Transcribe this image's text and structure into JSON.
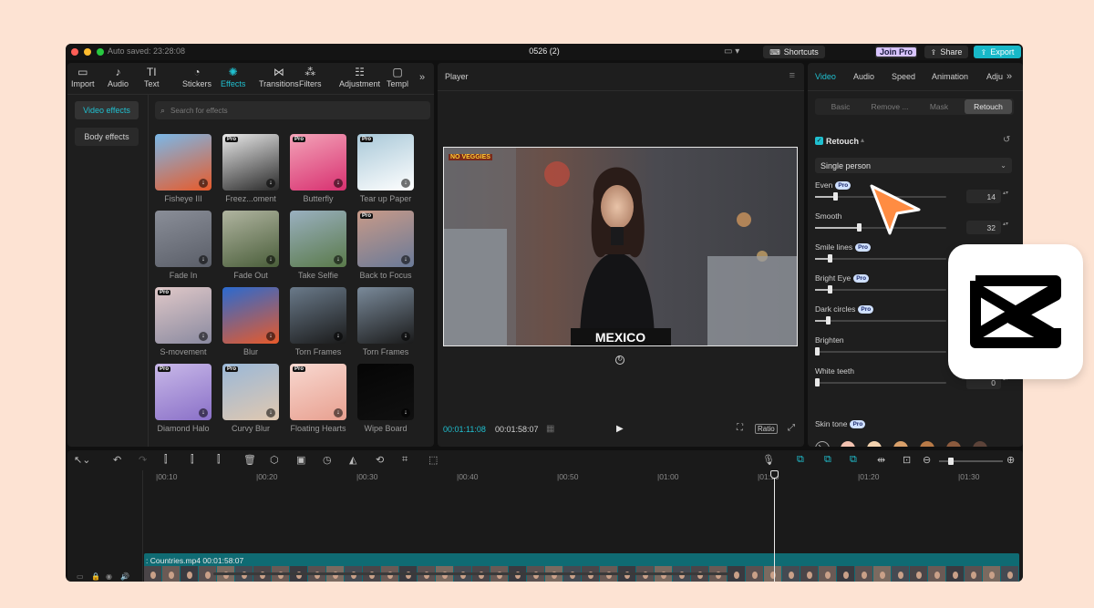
{
  "titlebar": {
    "autosave": "Auto saved: 23:28:08",
    "project": "0526 (2)",
    "shortcuts": "Shortcuts",
    "join_pro": "Join Pro",
    "share": "Share",
    "export": "Export"
  },
  "media_tabs": [
    {
      "label": "Import",
      "icon": "import-icon"
    },
    {
      "label": "Audio",
      "icon": "audio-icon"
    },
    {
      "label": "Text",
      "icon": "text-icon"
    },
    {
      "label": "Stickers",
      "icon": "stickers-icon"
    },
    {
      "label": "Effects",
      "icon": "effects-icon"
    },
    {
      "label": "Transitions",
      "icon": "transitions-icon"
    },
    {
      "label": "Filters",
      "icon": "filters-icon"
    },
    {
      "label": "Adjustment",
      "icon": "adjustment-icon"
    },
    {
      "label": "Templ",
      "icon": "templates-icon"
    }
  ],
  "effects_sidebar": {
    "video_effects": "Video effects",
    "body_effects": "Body effects"
  },
  "search": {
    "placeholder": "Search for effects"
  },
  "effects": [
    {
      "label": "Fisheye III",
      "pro": false
    },
    {
      "label": "Freez...oment",
      "pro": true
    },
    {
      "label": "Butterfly",
      "pro": true
    },
    {
      "label": "Tear up Paper",
      "pro": true
    },
    {
      "label": "Fade In",
      "pro": false
    },
    {
      "label": "Fade Out",
      "pro": false
    },
    {
      "label": "Take Selfie",
      "pro": false
    },
    {
      "label": "Back to Focus",
      "pro": true
    },
    {
      "label": "S-movement",
      "pro": true
    },
    {
      "label": "Blur",
      "pro": false
    },
    {
      "label": "Torn Frames",
      "pro": false
    },
    {
      "label": "Torn Frames",
      "pro": false
    },
    {
      "label": "Diamond Halo",
      "pro": true
    },
    {
      "label": "Curvy Blur",
      "pro": true
    },
    {
      "label": "Floating Hearts",
      "pro": true
    },
    {
      "label": "Wipe Board",
      "pro": false
    }
  ],
  "pro_badge": "Pro",
  "player": {
    "title": "Player",
    "caption": "MEXICO",
    "overlay_tag": "NO VEGGIES",
    "current_time": "00:01:11:08",
    "total_time": "00:01:58:07",
    "ratio": "Ratio"
  },
  "inspector": {
    "tabs": [
      "Video",
      "Audio",
      "Speed",
      "Animation",
      "Adju"
    ],
    "subtabs": [
      "Basic",
      "Remove ...",
      "Mask",
      "Retouch"
    ],
    "section": "Retouch",
    "face_mode": "Single person",
    "sliders": [
      {
        "label": "Even",
        "pro": true,
        "value": "14",
        "level": 0.14
      },
      {
        "label": "Smooth",
        "pro": false,
        "value": "32",
        "level": 0.32
      },
      {
        "label": "Smile lines",
        "pro": true,
        "value": "",
        "level": 0.1
      },
      {
        "label": "Bright Eye",
        "pro": true,
        "value": "",
        "level": 0.1
      },
      {
        "label": "Dark circles",
        "pro": true,
        "value": "",
        "level": 0.08
      },
      {
        "label": "Brighten",
        "pro": false,
        "value": "",
        "level": 0.0
      },
      {
        "label": "White teeth",
        "pro": false,
        "value": "0",
        "level": 0.0
      }
    ],
    "skin_tone_label": "Skin tone",
    "skin_tones": [
      "#f3c2b0",
      "#f3d2ae",
      "#d9a06a",
      "#b87a47",
      "#8c5b3e",
      "#5c4339"
    ]
  },
  "timeline": {
    "ticks": [
      "|00:10",
      "|00:20",
      "|00:30",
      "|00:40",
      "|00:50",
      "|01:00",
      "|01:10",
      "|01:20",
      "|01:30"
    ],
    "clip_label": ": Countries.mp4   00:01:58:07"
  },
  "colors": {
    "accent": "#20c0d0",
    "export": "#18b8c8",
    "join_pro": "#d8c4ff",
    "cursor": "#ff8c42"
  }
}
